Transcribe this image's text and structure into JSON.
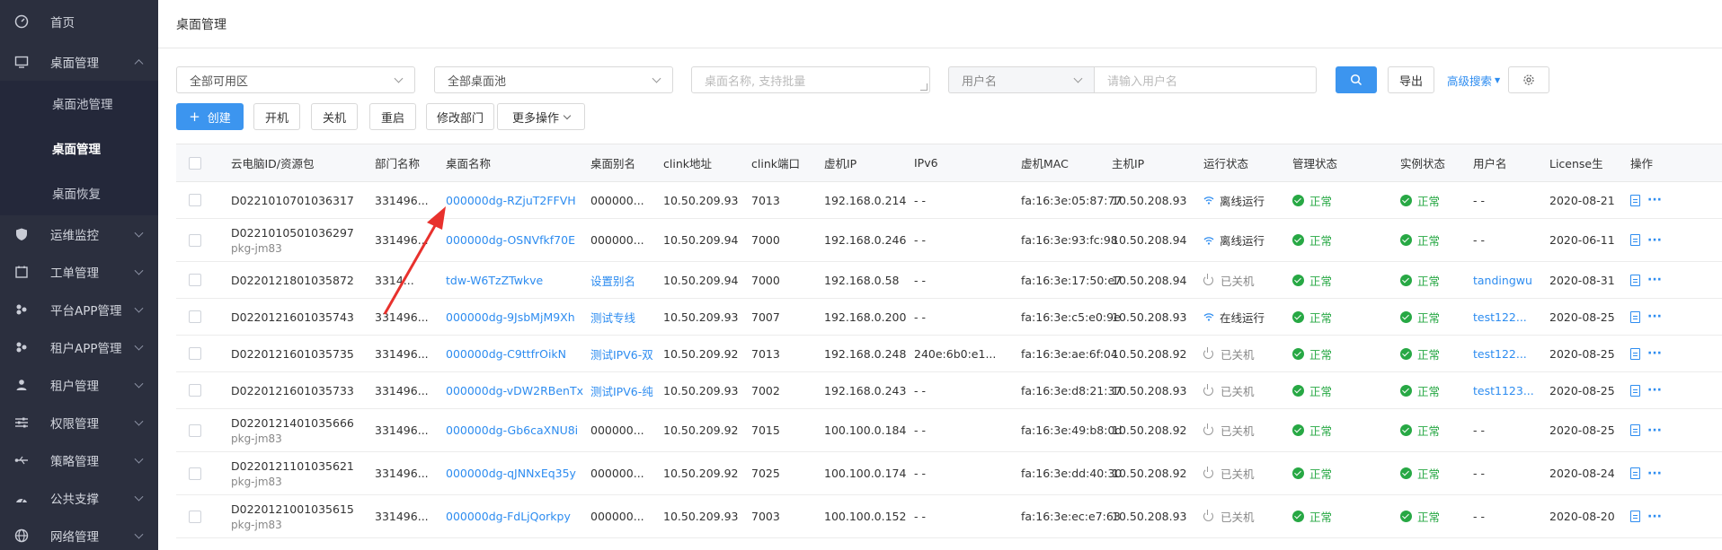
{
  "sidebar": {
    "items": [
      {
        "label": "首页",
        "icon": "dashboard-icon",
        "chevron": false
      },
      {
        "label": "桌面管理",
        "icon": "monitor-icon",
        "chevron": "up"
      },
      {
        "label": "运维监控",
        "icon": "shield-icon",
        "chevron": "down"
      },
      {
        "label": "工单管理",
        "icon": "ticket-icon",
        "chevron": "down"
      },
      {
        "label": "平台APP管理",
        "icon": "apps-icon",
        "chevron": "down"
      },
      {
        "label": "租户APP管理",
        "icon": "apps-icon",
        "chevron": "down"
      },
      {
        "label": "租户管理",
        "icon": "users-icon",
        "chevron": "down"
      },
      {
        "label": "权限管理",
        "icon": "sliders-icon",
        "chevron": "down"
      },
      {
        "label": "策略管理",
        "icon": "usb-icon",
        "chevron": "down"
      },
      {
        "label": "公共支撑",
        "icon": "gauge-icon",
        "chevron": "down"
      },
      {
        "label": "网络管理",
        "icon": "globe-icon",
        "chevron": "down"
      }
    ],
    "submenu": [
      {
        "label": "桌面池管理",
        "active": false
      },
      {
        "label": "桌面管理",
        "active": true
      },
      {
        "label": "桌面恢复",
        "active": false
      }
    ]
  },
  "header": {
    "title": "桌面管理"
  },
  "filters": {
    "zone_select": "全部可用区",
    "pool_select": "全部桌面池",
    "name_placeholder": "桌面名称, 支持批量",
    "user_field_select": "用户名",
    "user_placeholder": "请输入用户名",
    "export_label": "导出",
    "advanced_search_label": "高级搜索"
  },
  "toolbar": {
    "create_label": "创建",
    "power_on_label": "开机",
    "power_off_label": "关机",
    "restart_label": "重启",
    "modify_dept_label": "修改部门",
    "more_actions_label": "更多操作"
  },
  "table": {
    "columns": [
      "云电脑ID/资源包",
      "部门名称",
      "桌面名称",
      "桌面别名",
      "clink地址",
      "clink端口",
      "虚机IP",
      "IPv6",
      "虚机MAC",
      "主机IP",
      "运行状态",
      "管理状态",
      "实例状态",
      "用户名",
      "License生",
      "操作"
    ],
    "rows": [
      {
        "id": "D0221010701036317",
        "pkg": "",
        "dept": "331496...",
        "name": "000000dg-RZjuT2FFVH",
        "alias": "000000...",
        "alias_link": false,
        "clink": "10.50.209.93",
        "port": "7013",
        "vm_ip": "192.168.0.214",
        "ipv6": "- -",
        "mac": "fa:16:3e:05:87:77",
        "host_ip": "10.50.208.93",
        "run_state": "离线运行",
        "run_kind": "wifi",
        "manage": "正常",
        "instance": "正常",
        "user": "- -",
        "user_link": false,
        "license": "2020-08-21"
      },
      {
        "id": "D0221010501036297",
        "pkg": "pkg-jm83",
        "dept": "331496...",
        "name": "000000dg-OSNVfkf70E",
        "alias": "000000...",
        "alias_link": false,
        "clink": "10.50.209.94",
        "port": "7000",
        "vm_ip": "192.168.0.246",
        "ipv6": "- -",
        "mac": "fa:16:3e:93:fc:98",
        "host_ip": "10.50.208.94",
        "run_state": "离线运行",
        "run_kind": "wifi",
        "manage": "正常",
        "instance": "正常",
        "user": "- -",
        "user_link": false,
        "license": "2020-06-11"
      },
      {
        "id": "D0220121801035872",
        "pkg": "",
        "dept": "3314...",
        "name": "tdw-W6TzZTwkve",
        "alias": "设置别名",
        "alias_link": true,
        "clink": "10.50.209.94",
        "port": "7000",
        "vm_ip": "192.168.0.58",
        "ipv6": "- -",
        "mac": "fa:16:3e:17:50:e7",
        "host_ip": "10.50.208.94",
        "run_state": "已关机",
        "run_kind": "power",
        "manage": "正常",
        "instance": "正常",
        "user": "tandingwu",
        "user_link": true,
        "license": "2020-08-31"
      },
      {
        "id": "D0220121601035743",
        "pkg": "",
        "dept": "331496...",
        "name": "000000dg-9JsbMjM9Xh",
        "alias": "测试专线",
        "alias_link": true,
        "clink": "10.50.209.93",
        "port": "7007",
        "vm_ip": "192.168.0.200",
        "ipv6": "- -",
        "mac": "fa:16:3e:c5:e0:9e",
        "host_ip": "10.50.208.93",
        "run_state": "在线运行",
        "run_kind": "wifi",
        "manage": "正常",
        "instance": "正常",
        "user": "test122...",
        "user_link": true,
        "license": "2020-08-25"
      },
      {
        "id": "D0220121601035735",
        "pkg": "",
        "dept": "331496...",
        "name": "000000dg-C9ttfrOikN",
        "alias": "测试IPV6-双",
        "alias_link": true,
        "clink": "10.50.209.92",
        "port": "7013",
        "vm_ip": "192.168.0.248",
        "ipv6": "240e:6b0:e1...",
        "mac": "fa:16:3e:ae:6f:04",
        "host_ip": "10.50.208.92",
        "run_state": "已关机",
        "run_kind": "power",
        "manage": "正常",
        "instance": "正常",
        "user": "test122...",
        "user_link": true,
        "license": "2020-08-25"
      },
      {
        "id": "D0220121601035733",
        "pkg": "",
        "dept": "331496...",
        "name": "000000dg-vDW2RBenTx",
        "alias": "测试IPV6-纯",
        "alias_link": true,
        "clink": "10.50.209.93",
        "port": "7002",
        "vm_ip": "192.168.0.243",
        "ipv6": "- -",
        "mac": "fa:16:3e:d8:21:37",
        "host_ip": "10.50.208.93",
        "run_state": "已关机",
        "run_kind": "power",
        "manage": "正常",
        "instance": "正常",
        "user": "test1123...",
        "user_link": true,
        "license": "2020-08-25"
      },
      {
        "id": "D0220121401035666",
        "pkg": "pkg-jm83",
        "dept": "331496...",
        "name": "000000dg-Gb6caXNU8i",
        "alias": "000000...",
        "alias_link": false,
        "clink": "10.50.209.92",
        "port": "7015",
        "vm_ip": "100.100.0.184",
        "ipv6": "- -",
        "mac": "fa:16:3e:49:b8:0d",
        "host_ip": "10.50.208.92",
        "run_state": "已关机",
        "run_kind": "power",
        "manage": "正常",
        "instance": "正常",
        "user": "- -",
        "user_link": false,
        "license": "2020-08-25"
      },
      {
        "id": "D0220121101035621",
        "pkg": "pkg-jm83",
        "dept": "331496...",
        "name": "000000dg-qJNNxEq35y",
        "alias": "000000...",
        "alias_link": false,
        "clink": "10.50.209.92",
        "port": "7025",
        "vm_ip": "100.100.0.174",
        "ipv6": "- -",
        "mac": "fa:16:3e:dd:40:30",
        "host_ip": "10.50.208.92",
        "run_state": "已关机",
        "run_kind": "power",
        "manage": "正常",
        "instance": "正常",
        "user": "- -",
        "user_link": false,
        "license": "2020-08-24"
      },
      {
        "id": "D0220121001035615",
        "pkg": "pkg-jm83",
        "dept": "331496...",
        "name": "000000dg-FdLjQorkpy",
        "alias": "000000...",
        "alias_link": false,
        "clink": "10.50.209.93",
        "port": "7003",
        "vm_ip": "100.100.0.152",
        "ipv6": "- -",
        "mac": "fa:16:3e:ec:e7:63",
        "host_ip": "10.50.208.93",
        "run_state": "已关机",
        "run_kind": "power",
        "manage": "正常",
        "instance": "正常",
        "user": "- -",
        "user_link": false,
        "license": "2020-08-20"
      }
    ]
  },
  "colors": {
    "sidebar_bg": "#2b2f3e",
    "primary": "#3c95ef",
    "link": "#2d8cf0",
    "ok": "#27a844",
    "annotation_arrow": "#e8312d"
  }
}
